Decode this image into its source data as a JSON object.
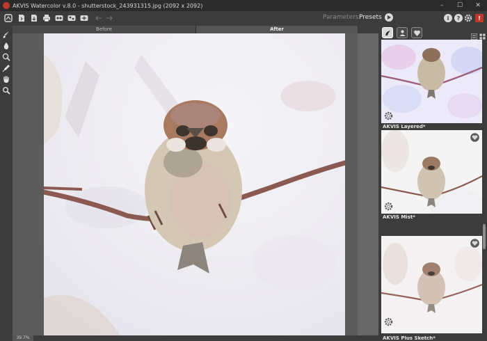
{
  "window": {
    "title": "AKVIS Watercolor v.8.0 - shutterstock_243931315.jpg (2092 x 2092)",
    "minimize": "–",
    "maximize": "☐",
    "close": "✕"
  },
  "toolbar": {
    "icons": [
      "home-icon",
      "open-file-icon",
      "save-file-icon",
      "print-icon",
      "batch-icon",
      "share-icon",
      "plugin-icon",
      "undo-icon",
      "redo-icon"
    ],
    "tab_parameters": "Parameters",
    "tab_presets": "Presets",
    "info_label": "i",
    "help_label": "?",
    "notify_label": "!"
  },
  "left_tools": [
    "brush-icon",
    "drop-icon",
    "sponge-icon",
    "eyedropper-icon",
    "hand-icon",
    "zoom-icon"
  ],
  "view_tabs": {
    "before": "Before",
    "after": "After"
  },
  "status": {
    "zoom": "39.7%"
  },
  "right_panel": {
    "filter_tabs": [
      "all-presets-icon",
      "user-presets-icon",
      "favorites-icon"
    ],
    "presets": [
      {
        "name": "AKVIS Layered*"
      },
      {
        "name": "AKVIS Mist*"
      },
      {
        "name": "AKVIS Plus Sketch*"
      }
    ]
  },
  "colors": {
    "background": "#3c3c3c",
    "titlebar": "#2b2b2b",
    "canvas_bg": "#5b5b5b",
    "accent_red": "#c0392b"
  }
}
